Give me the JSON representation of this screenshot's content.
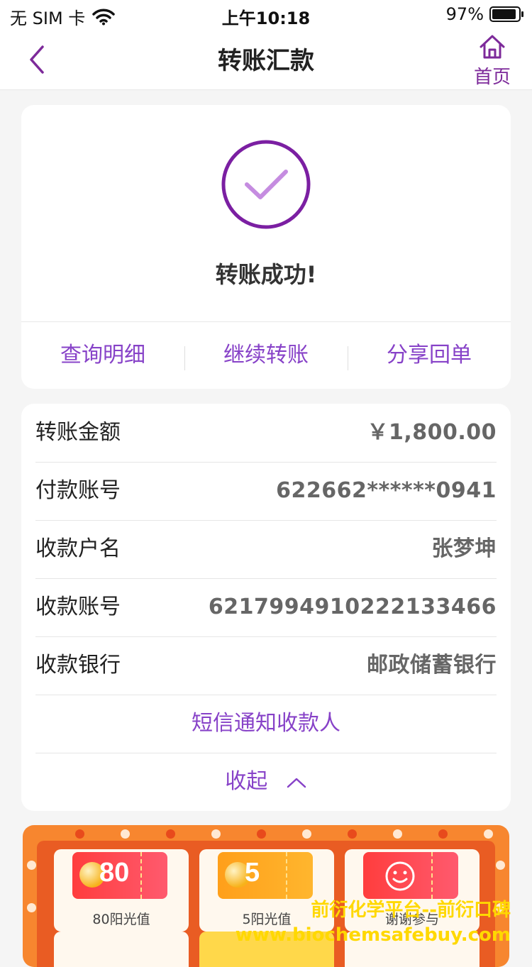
{
  "status_bar": {
    "carrier": "无 SIM 卡",
    "time": "上午10:18",
    "battery": "97%",
    "battery_level": 0.97
  },
  "nav": {
    "title": "转账汇款",
    "home_label": "首页"
  },
  "success": {
    "message": "转账成功!",
    "actions": [
      {
        "label": "查询明细"
      },
      {
        "label": "继续转账"
      },
      {
        "label": "分享回单"
      }
    ]
  },
  "details": {
    "rows": [
      {
        "label": "转账金额",
        "value": "￥1,800.00"
      },
      {
        "label": "付款账号",
        "value": "622662******0941"
      },
      {
        "label": "收款户名",
        "value": "张梦坤"
      },
      {
        "label": "收款账号",
        "value": "6217994910222133466"
      },
      {
        "label": "收款银行",
        "value": "邮政储蓄银行"
      }
    ],
    "sms_link": "短信通知收款人",
    "collapse": "收起"
  },
  "promo": {
    "tiles": [
      {
        "number": "80",
        "label": "80阳光值"
      },
      {
        "number": "5",
        "label": "5阳光值"
      },
      {
        "number": "",
        "label": "谢谢参与"
      }
    ]
  },
  "watermark": {
    "line1": "前衍化学平台--前衍口碑",
    "line2": "www.biochemsafebuy.com"
  },
  "colors": {
    "accent": "#8742c8",
    "success_ring": "#7b1fa2",
    "check": "#c58ce0",
    "promo_orange": "#f7862f"
  }
}
